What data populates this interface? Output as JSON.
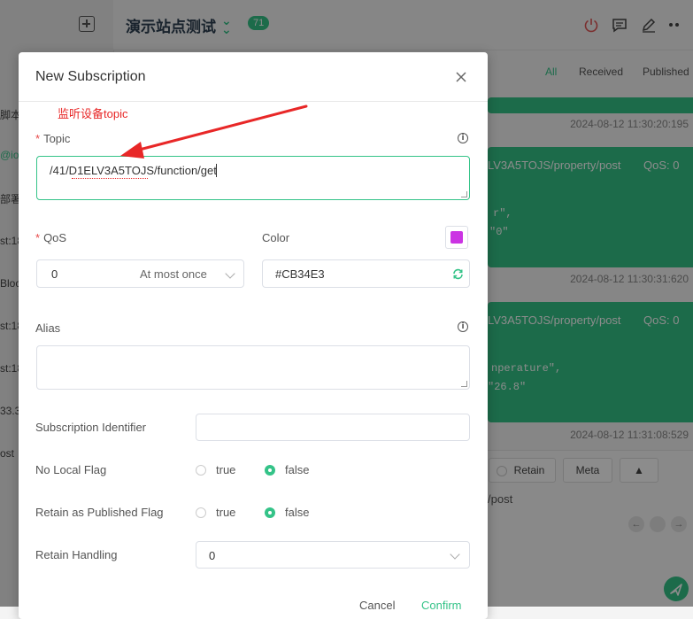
{
  "app": {
    "connection_name": "演示站点测试",
    "message_count": "71",
    "sidebar_fragments": [
      "脚本",
      "@iot",
      "部署",
      "st:18",
      "Bloc",
      "st:18",
      "st:18",
      "33.3",
      "ost"
    ]
  },
  "filters": {
    "all": "All",
    "received": "Received",
    "published": "Published"
  },
  "messages": [
    {
      "time": "2024-08-12 11:30:20:195"
    },
    {
      "topic": "LV3A5TOJS/property/post",
      "qos": "QoS: 0",
      "line1": "r\",",
      "line2": "\"0\"",
      "time": "2024-08-12 11:30:31:620"
    },
    {
      "topic": "LV3A5TOJS/property/post",
      "qos": "QoS: 0",
      "line1": "nperature\",",
      "line2": "\"26.8\"",
      "time": "2024-08-12 11:31:08:529"
    }
  ],
  "composer": {
    "retain": "Retain",
    "meta": "Meta",
    "topic_fragment": "/post"
  },
  "dialog": {
    "title": "New Subscription",
    "annotation": "监听设备topic",
    "topic_label": "Topic",
    "topic_value": "/41/D1ELV3A5TOJS/function/get",
    "qos_label": "QoS",
    "qos_value": "0",
    "qos_desc": "At most once",
    "color_label": "Color",
    "color_value": "#CB34E3",
    "alias_label": "Alias",
    "alias_value": "",
    "sub_id_label": "Subscription Identifier",
    "sub_id_value": "",
    "no_local_label": "No Local Flag",
    "rap_label": "Retain as Published Flag",
    "true_label": "true",
    "false_label": "false",
    "no_local_selected": "false",
    "rap_selected": "false",
    "retain_handling_label": "Retain Handling",
    "retain_handling_value": "0",
    "cancel": "Cancel",
    "confirm": "Confirm"
  },
  "colors": {
    "accent": "#34c388",
    "swatch": "#CB34E3",
    "annotation": "#e82727",
    "required": "#e84a4a"
  },
  "icons": [
    "plus-icon",
    "chevron-double-down-icon",
    "power-icon",
    "comment-icon",
    "edit-icon",
    "close-icon",
    "info-icon",
    "refresh-icon",
    "chevron-down-icon",
    "send-icon"
  ]
}
